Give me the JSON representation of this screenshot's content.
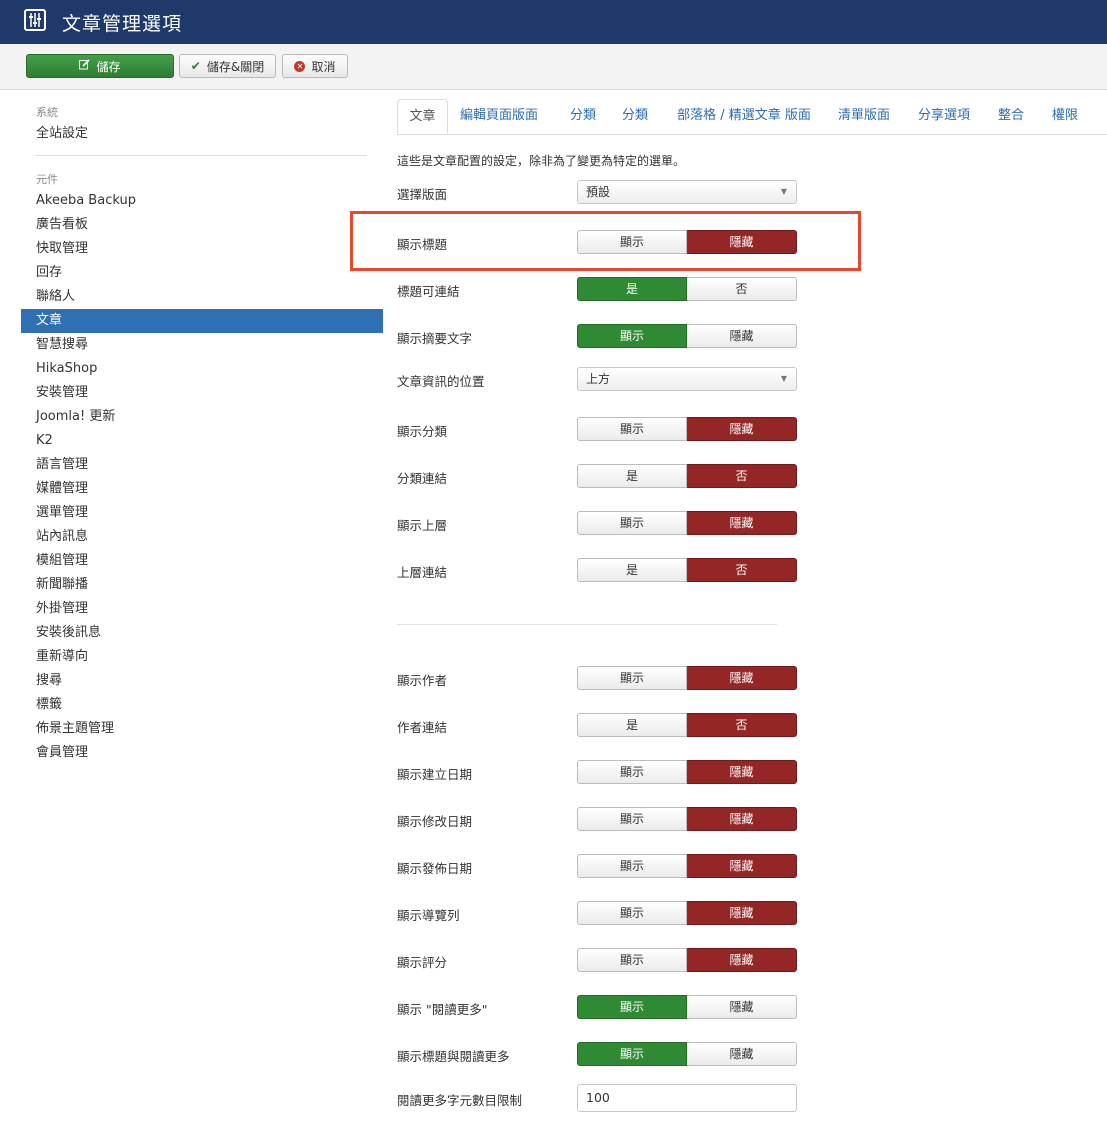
{
  "header": {
    "title": "文章管理選項"
  },
  "toolbar": {
    "save": "儲存",
    "save_close": "儲存&關閉",
    "cancel": "取消"
  },
  "sidebar": {
    "system_heading": "系統",
    "system_items": [
      "全站設定"
    ],
    "component_heading": "元件",
    "component_items": [
      "Akeeba Backup",
      "廣告看板",
      "快取管理",
      "回存",
      "聯絡人",
      "文章",
      "智慧搜尋",
      "HikaShop",
      "安裝管理",
      "Joomla! 更新",
      "K2",
      "語言管理",
      "媒體管理",
      "選單管理",
      "站內訊息",
      "模組管理",
      "新聞聯播",
      "外掛管理",
      "安裝後訊息",
      "重新導向",
      "搜尋",
      "標籤",
      "佈景主題管理",
      "會員管理"
    ],
    "active": "文章"
  },
  "tabs": [
    "文章",
    "編輯頁面版面",
    "分類",
    "分類",
    "部落格 / 精選文章 版面",
    "清單版面",
    "分享選項",
    "整合",
    "權限"
  ],
  "description": "這些是文章配置的設定，除非為了變更為特定的選單。",
  "fields": [
    {
      "label": "選擇版面",
      "type": "select",
      "value": "預設"
    },
    {
      "label": "顯示標題",
      "type": "toggle",
      "options": [
        "顯示",
        "隱藏"
      ],
      "selected": 1
    },
    {
      "label": "標題可連結",
      "type": "toggle",
      "options": [
        "是",
        "否"
      ],
      "selected": 0
    },
    {
      "label": "顯示摘要文字",
      "type": "toggle",
      "options": [
        "顯示",
        "隱藏"
      ],
      "selected": 0
    },
    {
      "label": "文章資訊的位置",
      "type": "select",
      "value": "上方"
    },
    {
      "label": "顯示分類",
      "type": "toggle",
      "options": [
        "顯示",
        "隱藏"
      ],
      "selected": 1
    },
    {
      "label": "分類連結",
      "type": "toggle",
      "options": [
        "是",
        "否"
      ],
      "selected": 1
    },
    {
      "label": "顯示上層",
      "type": "toggle",
      "options": [
        "顯示",
        "隱藏"
      ],
      "selected": 1
    },
    {
      "label": "上層連結",
      "type": "toggle",
      "options": [
        "是",
        "否"
      ],
      "selected": 1
    },
    {
      "label": "顯示作者",
      "type": "toggle",
      "options": [
        "顯示",
        "隱藏"
      ],
      "selected": 1
    },
    {
      "label": "作者連結",
      "type": "toggle",
      "options": [
        "是",
        "否"
      ],
      "selected": 1
    },
    {
      "label": "顯示建立日期",
      "type": "toggle",
      "options": [
        "顯示",
        "隱藏"
      ],
      "selected": 1
    },
    {
      "label": "顯示修改日期",
      "type": "toggle",
      "options": [
        "顯示",
        "隱藏"
      ],
      "selected": 1
    },
    {
      "label": "顯示發佈日期",
      "type": "toggle",
      "options": [
        "顯示",
        "隱藏"
      ],
      "selected": 1
    },
    {
      "label": "顯示導覽列",
      "type": "toggle",
      "options": [
        "顯示",
        "隱藏"
      ],
      "selected": 1
    },
    {
      "label": "顯示評分",
      "type": "toggle",
      "options": [
        "顯示",
        "隱藏"
      ],
      "selected": 1
    },
    {
      "label": "顯示 \"閱讀更多\"",
      "type": "toggle",
      "options": [
        "顯示",
        "隱藏"
      ],
      "selected": 0
    },
    {
      "label": "顯示標題與閱讀更多",
      "type": "toggle",
      "options": [
        "顯示",
        "隱藏"
      ],
      "selected": 0
    },
    {
      "label": "閱讀更多字元數目限制",
      "type": "text",
      "value": "100"
    }
  ],
  "colors": {
    "header": "#1f3a6a",
    "active_sidebar": "#2f70b4",
    "toggle_green": "#2f8a34",
    "toggle_red": "#952626",
    "highlight": "#e8492e",
    "link": "#2d6cb4"
  }
}
